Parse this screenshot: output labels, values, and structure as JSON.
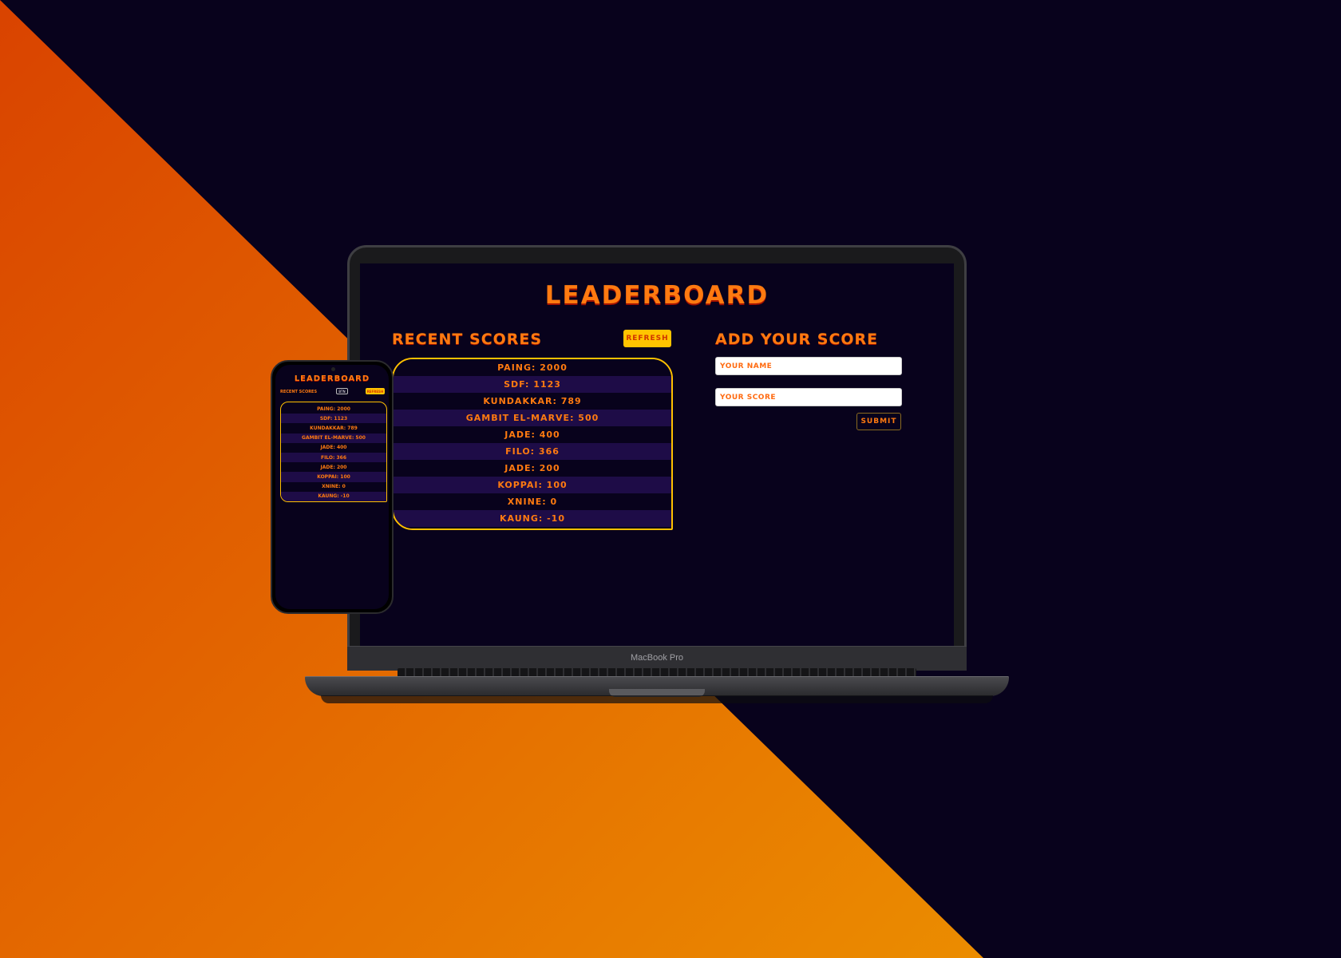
{
  "app": {
    "title": "Leaderboard",
    "recent_heading": "Recent Scores",
    "refresh_label": "Refresh",
    "add_heading": "Add Your Score",
    "name_placeholder": "Your Name",
    "score_placeholder": "Your Score",
    "submit_label": "Submit",
    "scores": [
      "Paing: 2000",
      "SDF: 1123",
      "Kundakkar: 789",
      "Gambit El-Marve: 500",
      "Jade: 400",
      "Filo: 366",
      "Jade: 200",
      "Koppai: 100",
      "Xnine: 0",
      "Kaung: -10"
    ]
  },
  "device": {
    "laptop_label": "MacBook Pro"
  },
  "phone": {
    "title": "Leaderboard",
    "recent_heading": "Recent Scores",
    "chip_label": "BTN",
    "action_label": "Refresh"
  },
  "colors": {
    "background": "#08021c",
    "accent_orange": "#ff7a10",
    "accent_yellow": "#ffc400",
    "row_alt": "#1e0c47"
  }
}
